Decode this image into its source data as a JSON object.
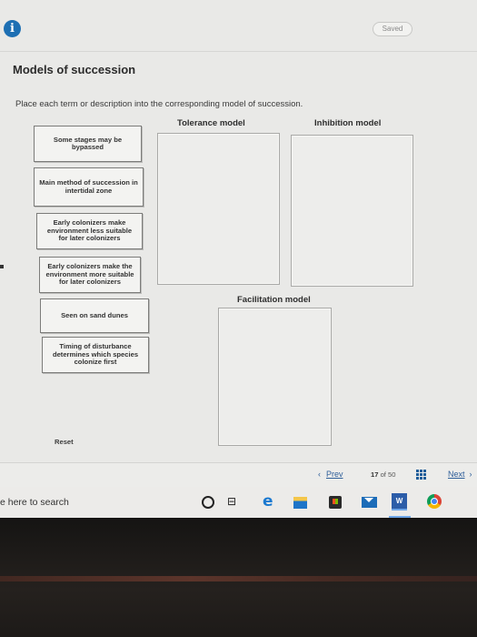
{
  "header": {
    "info_icon": "i",
    "saved_label": "Saved"
  },
  "page": {
    "title": "Models of succession",
    "instructions": "Place each term or description into the corresponding model of succession."
  },
  "zones": {
    "tolerance": "Tolerance model",
    "inhibition": "Inhibition model",
    "facilitation": "Facilitation model"
  },
  "cards": [
    "Some stages may be bypassed",
    "Main method of succession in intertidal zone",
    "Early colonizers make environment less suitable for later colonizers",
    "Early colonizers make the environment more suitable for later colonizers",
    "Seen on sand dunes",
    "Timing of disturbance determines which species colonize first"
  ],
  "reset_label": "Reset",
  "nav": {
    "prev_arrow": "‹",
    "prev_label": "Prev",
    "current": "17",
    "of_label": "of",
    "total": "50",
    "next_label": "Next",
    "next_arrow": "›"
  },
  "taskbar": {
    "search_text": "e here to search",
    "word_label": "W",
    "taskview_glyph": "⊟",
    "edge_glyph": "e"
  }
}
